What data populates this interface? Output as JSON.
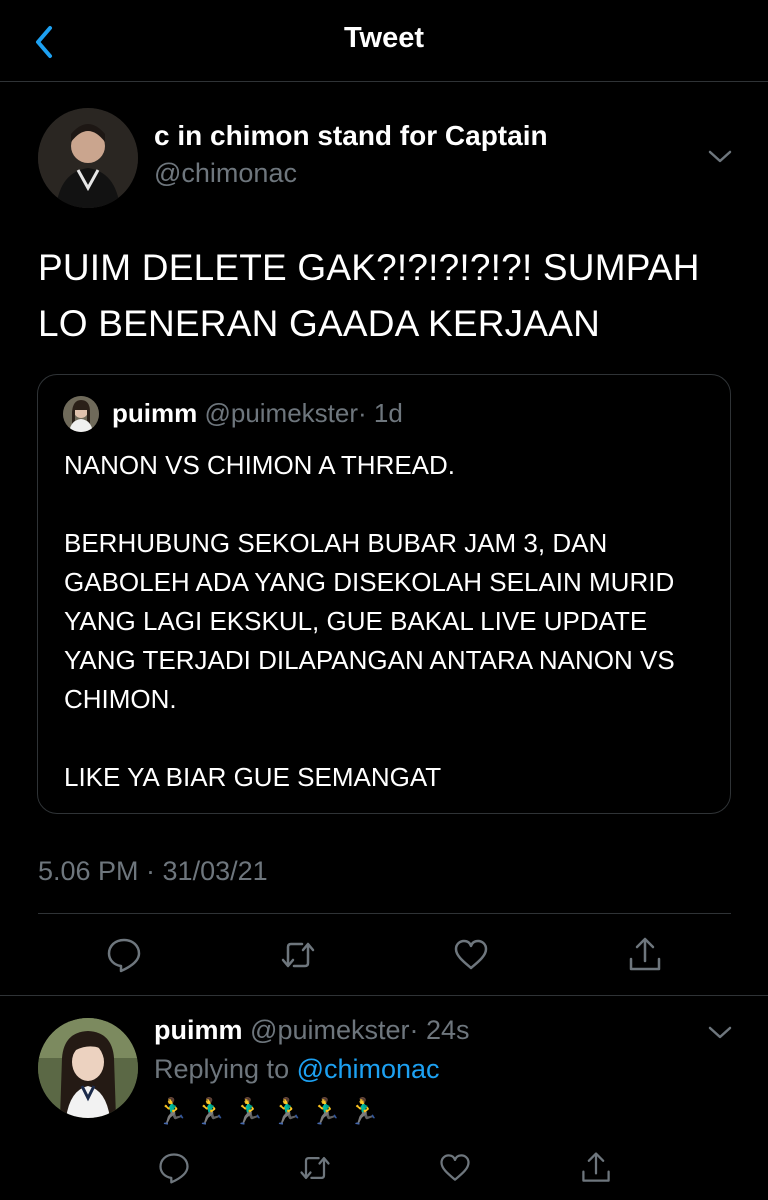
{
  "header": {
    "title": "Tweet",
    "back_icon": "chevron-left-icon"
  },
  "tweet": {
    "display_name": "c in chimon stand for Captain",
    "handle": "@chimonac",
    "text": "PUIM DELETE GAK?!?!?!?!?! SUMPAH LO BENERAN GAADA KERJAAN",
    "timestamp": "5.06 PM · 31/03/21",
    "quoted": {
      "display_name": "puimm",
      "handle": "@puimekster",
      "age": "· 1d",
      "text": "NANON VS CHIMON A THREAD.\n\nBERHUBUNG SEKOLAH BUBAR JAM 3, DAN GABOLEH ADA YANG DISEKOLAH SELAIN MURID YANG LAGI EKSKUL, GUE BAKAL LIVE UPDATE YANG TERJADI DILAPANGAN ANTARA NANON VS CHIMON.\n\nLIKE YA BIAR GUE SEMANGAT"
    },
    "actions": [
      "reply-icon",
      "retweet-icon",
      "like-icon",
      "share-icon"
    ]
  },
  "reply": {
    "display_name": "puimm",
    "handle": "@puimekster",
    "age": "· 24s",
    "replying_prefix": "Replying to ",
    "replying_to": "@chimonac",
    "text": "🏃‍♂️🏃‍♂️🏃‍♂️🏃‍♂️🏃‍♂️🏃‍♂️"
  },
  "colors": {
    "background": "#000000",
    "link": "#1da1f2",
    "muted": "#6e767d",
    "border": "#2f3336"
  }
}
